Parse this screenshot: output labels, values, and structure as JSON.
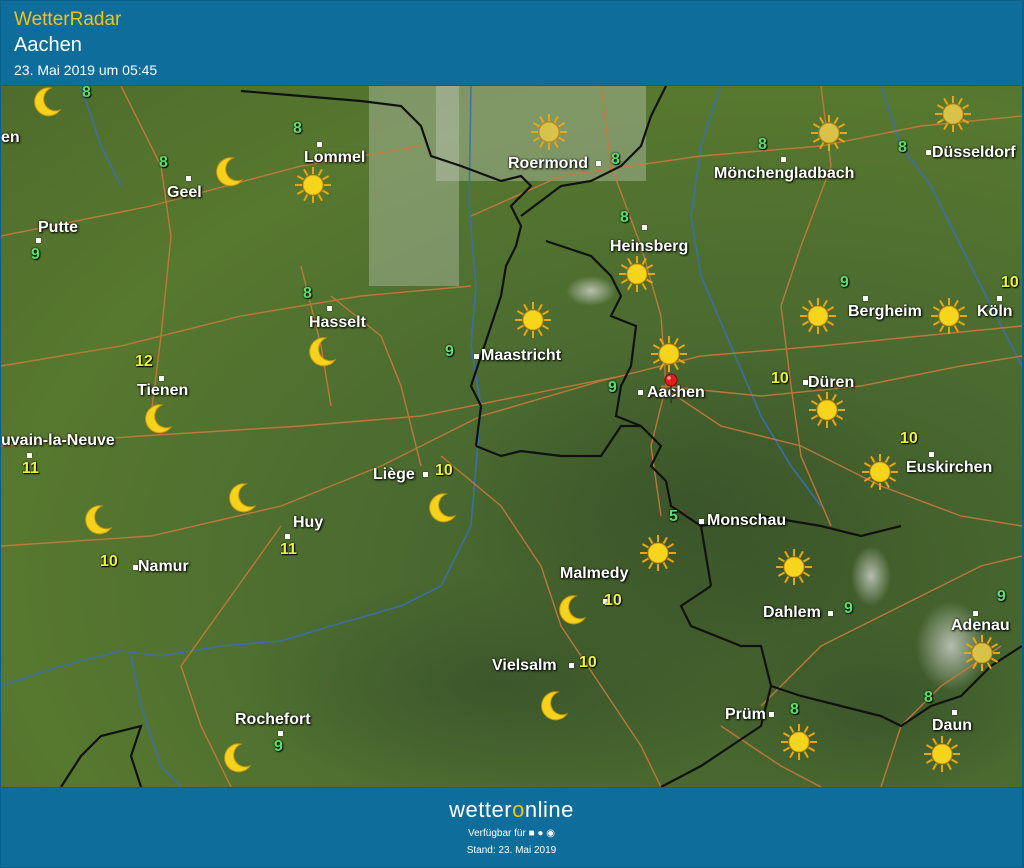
{
  "header": {
    "app_title": "WetterRadar",
    "city": "Aachen",
    "datetime": "23. Mai 2019 um 05:45"
  },
  "map": {
    "places": [
      {
        "id": "lommel",
        "name": "Lommel"
      },
      {
        "id": "geel",
        "name": "Geel"
      },
      {
        "id": "putte",
        "name": "Putte"
      },
      {
        "id": "hasselt",
        "name": "Hasselt"
      },
      {
        "id": "tienen",
        "name": "Tienen"
      },
      {
        "id": "louvain",
        "name": "uvain-la-Neuve"
      },
      {
        "id": "namur",
        "name": "Namur"
      },
      {
        "id": "huy",
        "name": "Huy"
      },
      {
        "id": "liege",
        "name": "Liège"
      },
      {
        "id": "rochefort",
        "name": "Rochefort"
      },
      {
        "id": "roermond",
        "name": "Roermond"
      },
      {
        "id": "maastricht",
        "name": "Maastricht"
      },
      {
        "id": "heinsberg",
        "name": "Heinsberg"
      },
      {
        "id": "moenchengladbach",
        "name": "Mönchengladbach"
      },
      {
        "id": "duesseldorf",
        "name": "Düsseldorf"
      },
      {
        "id": "bergheim",
        "name": "Bergheim"
      },
      {
        "id": "koeln",
        "name": "Köln"
      },
      {
        "id": "aachen",
        "name": "Aachen"
      },
      {
        "id": "dueren",
        "name": "Düren"
      },
      {
        "id": "euskirchen",
        "name": "Euskirchen"
      },
      {
        "id": "monschau",
        "name": "Monschau"
      },
      {
        "id": "malmedy",
        "name": "Malmedy"
      },
      {
        "id": "vielsalm",
        "name": "Vielsalm"
      },
      {
        "id": "dahlem",
        "name": "Dahlem"
      },
      {
        "id": "adenau",
        "name": "Adenau"
      },
      {
        "id": "pruem",
        "name": "Prüm"
      },
      {
        "id": "daun",
        "name": "Daun"
      },
      {
        "id": "en",
        "name": "en"
      }
    ],
    "temps": [
      {
        "id": "t-8-a",
        "value": "8",
        "color": "green"
      },
      {
        "id": "t-8-lommel",
        "value": "8",
        "color": "green"
      },
      {
        "id": "t-8-geel",
        "value": "8",
        "color": "green"
      },
      {
        "id": "t-9-putte",
        "value": "9",
        "color": "green"
      },
      {
        "id": "t-8-hasselt",
        "value": "8",
        "color": "green"
      },
      {
        "id": "t-12-tienen",
        "value": "12",
        "color": "yellow"
      },
      {
        "id": "t-11-louvain",
        "value": "11",
        "color": "yellow"
      },
      {
        "id": "t-10-namur",
        "value": "10",
        "color": "yellow"
      },
      {
        "id": "t-11-huy",
        "value": "11",
        "color": "yellow"
      },
      {
        "id": "t-10-liege",
        "value": "10",
        "color": "yellow"
      },
      {
        "id": "t-9-rochefort",
        "value": "9",
        "color": "green"
      },
      {
        "id": "t-8-roermond",
        "value": "8",
        "color": "green"
      },
      {
        "id": "t-9-maastricht",
        "value": "9",
        "color": "green"
      },
      {
        "id": "t-8-heinsberg",
        "value": "8",
        "color": "green"
      },
      {
        "id": "t-8-mgladbach",
        "value": "8",
        "color": "green"
      },
      {
        "id": "t-8-duesseldorf",
        "value": "8",
        "color": "green"
      },
      {
        "id": "t-9-bergheim",
        "value": "9",
        "color": "green"
      },
      {
        "id": "t-10-koeln",
        "value": "10",
        "color": "yellow"
      },
      {
        "id": "t-9-aachen",
        "value": "9",
        "color": "green"
      },
      {
        "id": "t-10-dueren",
        "value": "10",
        "color": "yellow"
      },
      {
        "id": "t-10-euskirchen",
        "value": "10",
        "color": "yellow"
      },
      {
        "id": "t-5-monschau",
        "value": "5",
        "color": "green"
      },
      {
        "id": "t-10-malmedy",
        "value": "10",
        "color": "yellow"
      },
      {
        "id": "t-10-vielsalm",
        "value": "10",
        "color": "yellow"
      },
      {
        "id": "t-9-dahlem",
        "value": "9",
        "color": "green"
      },
      {
        "id": "t-9-adenau",
        "value": "9",
        "color": "green"
      },
      {
        "id": "t-8-pruem",
        "value": "8",
        "color": "green"
      },
      {
        "id": "t-8-daun",
        "value": "8",
        "color": "green"
      }
    ],
    "icon_types": [
      "sun-icon",
      "moon-icon",
      "location-pin-icon"
    ]
  },
  "footer": {
    "logo_part1": "wetter",
    "logo_o": "o",
    "logo_part2": "nline",
    "available_text": "Verfügbar für",
    "platform_icons": "android-icon apple-icon web-icon",
    "stand": "Stand: 23. Mai 2019"
  },
  "colors": {
    "header_bg": "#0f6d9c",
    "title_yellow": "#f2c21b",
    "temp_green": "#58e06a",
    "temp_yellow": "#ecf23a",
    "map_green": "#4e6c2c",
    "border_black": "#111111",
    "road_orange": "#c97a3a",
    "river_blue": "#3a6fb0"
  }
}
